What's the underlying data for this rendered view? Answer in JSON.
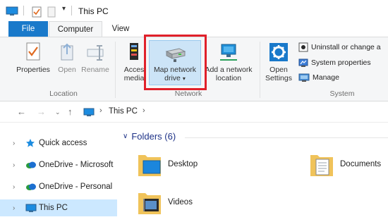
{
  "window": {
    "title": "This PC"
  },
  "tabs": {
    "file": "File",
    "computer": "Computer",
    "view": "View"
  },
  "ribbon": {
    "location": {
      "label": "Location",
      "properties": "Properties",
      "open": "Open",
      "rename": "Rename"
    },
    "network": {
      "label": "Network",
      "access_media_l1": "Acces",
      "access_media_l2": "media",
      "map_drive_l1": "Map network",
      "map_drive_l2": "drive",
      "add_location_l1": "Add a network",
      "add_location_l2": "location"
    },
    "system": {
      "label": "System",
      "open_settings_l1": "Open",
      "open_settings_l2": "Settings",
      "uninstall": "Uninstall or change a",
      "system_properties": "System properties",
      "manage": "Manage"
    }
  },
  "address": {
    "path_root_chevron": "›",
    "location": "This PC",
    "trailing_chevron": "›"
  },
  "nav_pane": {
    "items": [
      {
        "label": "Quick access"
      },
      {
        "label": "OneDrive - Microsoft"
      },
      {
        "label": "OneDrive - Personal"
      },
      {
        "label": "This PC"
      }
    ]
  },
  "content": {
    "section_title": "Folders (6)",
    "folders": [
      {
        "name": "Desktop"
      },
      {
        "name": "Documents"
      },
      {
        "name": "Videos"
      }
    ]
  },
  "colors": {
    "accent": "#1979ca",
    "highlight": "#e0202a",
    "selected": "#cce8ff"
  }
}
